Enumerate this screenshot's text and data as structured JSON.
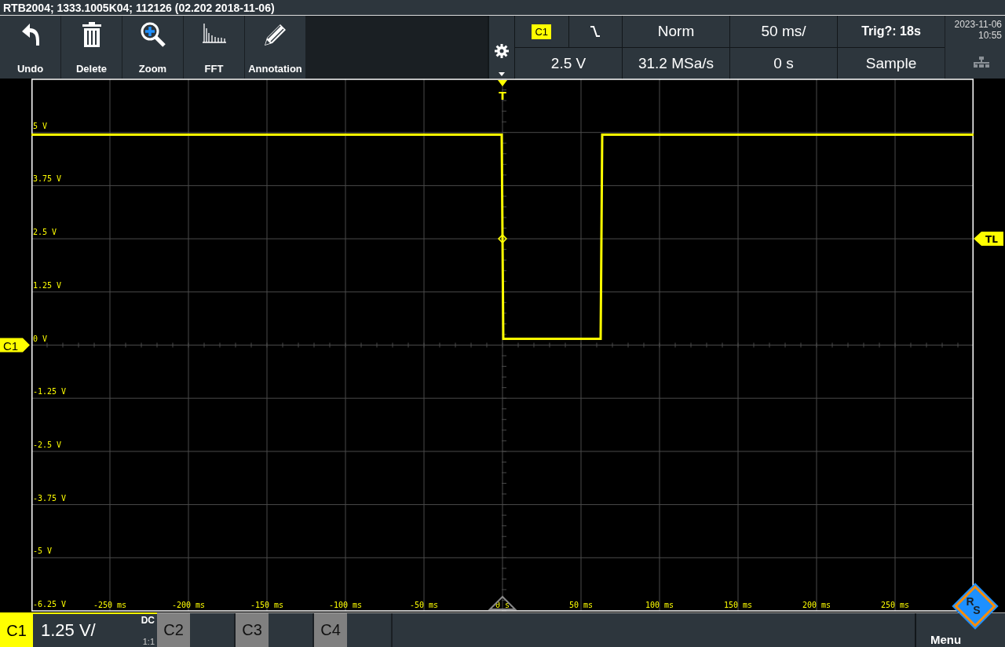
{
  "title_bar": "RTB2004; 1333.1005K04; 112126 (02.202 2018-11-06)",
  "toolbar": [
    {
      "label": "Undo",
      "kind": "undo"
    },
    {
      "label": "Delete",
      "kind": "delete"
    },
    {
      "label": "Zoom",
      "kind": "zoom"
    },
    {
      "label": "FFT",
      "kind": "fft"
    },
    {
      "label": "Annotation",
      "kind": "annotation"
    }
  ],
  "settings": {
    "trigger_source": "C1",
    "trigger_mode": "Norm",
    "time_scale": "50 ms/",
    "trigger_status": "Trig?: 18s",
    "trigger_level": "2.5 V",
    "sample_rate": "31.2 MSa/s",
    "time_offset": "0 s",
    "acquisition": "Sample"
  },
  "clock": {
    "date": "2023-11-06",
    "time": "10:55"
  },
  "markers": {
    "trigger": "T",
    "trigger_level": "TL"
  },
  "plot": {
    "chart_data": {
      "type": "line",
      "x": [
        -300,
        -0.5,
        0.5,
        62.5,
        63.5,
        300
      ],
      "grid": true,
      "series": [
        {
          "name": "C1",
          "color": "#ffff00",
          "values": [
            4.95,
            4.95,
            0.15,
            0.15,
            4.95,
            4.95
          ]
        }
      ],
      "xlim": [
        -300,
        300
      ],
      "ylim": [
        -6.25,
        6.25
      ],
      "xticks": [
        {
          "value": -250,
          "label": "-250 ms"
        },
        {
          "value": -200,
          "label": "-200 ms"
        },
        {
          "value": -150,
          "label": "-150 ms"
        },
        {
          "value": -100,
          "label": "-100 ms"
        },
        {
          "value": -50,
          "label": "-50 ms"
        },
        {
          "value": 0,
          "label": "0 s"
        },
        {
          "value": 50,
          "label": "50 ms"
        },
        {
          "value": 100,
          "label": "100 ms"
        },
        {
          "value": 150,
          "label": "150 ms"
        },
        {
          "value": 200,
          "label": "200 ms"
        },
        {
          "value": 250,
          "label": "250 ms"
        }
      ],
      "yticks": [
        {
          "value": 5,
          "label": "5 V"
        },
        {
          "value": 3.75,
          "label": "3.75 V"
        },
        {
          "value": 2.5,
          "label": "2.5 V"
        },
        {
          "value": 1.25,
          "label": "1.25 V"
        },
        {
          "value": 0,
          "label": "0 V"
        },
        {
          "value": -1.25,
          "label": "-1.25 V"
        },
        {
          "value": -2.5,
          "label": "-2.5 V"
        },
        {
          "value": -3.75,
          "label": "-3.75 V"
        },
        {
          "value": -5,
          "label": "-5 V"
        },
        {
          "value": -6.25,
          "label": "-6.25 V"
        }
      ]
    }
  },
  "channels": [
    {
      "label": "C1",
      "active": true,
      "scale": "1.25 V/",
      "coupling": "DC",
      "probe": "1:1"
    },
    {
      "label": "C2",
      "active": false
    },
    {
      "label": "C3",
      "active": false
    },
    {
      "label": "C4",
      "active": false
    }
  ],
  "logo": {
    "letters": [
      "R",
      "S"
    ],
    "label": "Menu"
  }
}
